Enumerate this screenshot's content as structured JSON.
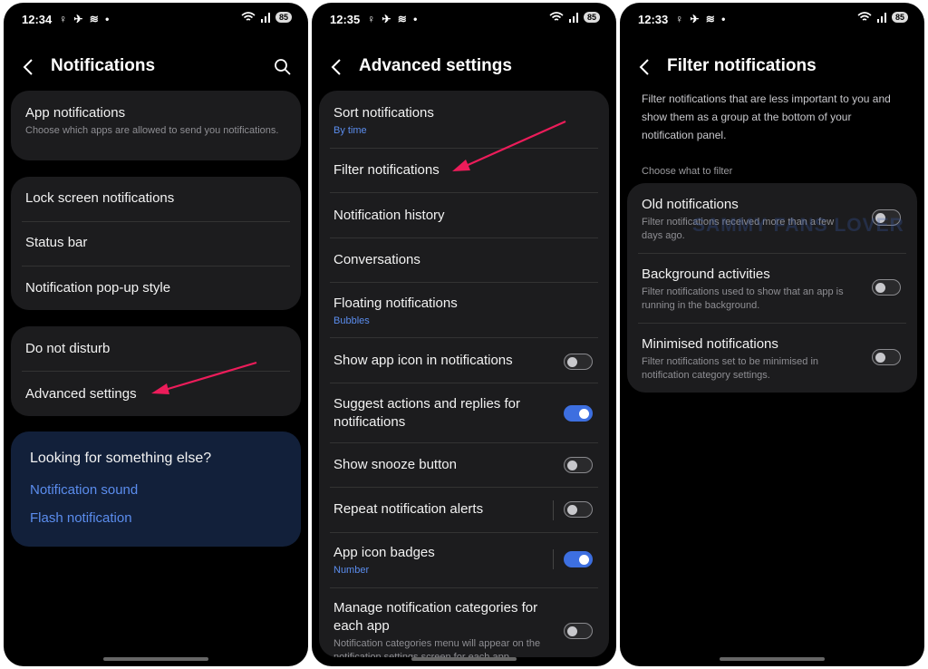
{
  "colors": {
    "accent": "#5b8dee",
    "arrow": "#ec1c5a",
    "toggle_on": "#3d6fe0",
    "card": "#1c1c1e"
  },
  "screen1": {
    "status": {
      "time": "12:34",
      "icons": "♀ ✈ ≋ •",
      "battery": "85"
    },
    "title": "Notifications",
    "app_notifications": {
      "title": "App notifications",
      "subtitle": "Choose which apps are allowed to send you notifications."
    },
    "items": [
      "Lock screen notifications",
      "Status bar",
      "Notification pop-up style"
    ],
    "items2": [
      "Do not disturb",
      "Advanced settings"
    ],
    "looking": {
      "heading": "Looking for something else?",
      "links": [
        "Notification sound",
        "Flash notification"
      ]
    }
  },
  "screen2": {
    "status": {
      "time": "12:35",
      "icons": "♀ ✈ ≋ •",
      "battery": "85"
    },
    "title": "Advanced settings",
    "rows": [
      {
        "title": "Sort notifications",
        "subtitle": "By time"
      },
      {
        "title": "Filter notifications"
      },
      {
        "title": "Notification history"
      },
      {
        "title": "Conversations"
      },
      {
        "title": "Floating notifications",
        "subtitle": "Bubbles"
      },
      {
        "title": "Show app icon in notifications",
        "toggle": false
      },
      {
        "title": "Suggest actions and replies for notifications",
        "toggle": true
      },
      {
        "title": "Show snooze button",
        "toggle": false
      },
      {
        "title": "Repeat notification alerts",
        "toggle": false
      },
      {
        "title": "App icon badges",
        "subtitle": "Number",
        "toggle": true
      },
      {
        "title": "Manage notification categories for each app",
        "subtitle": "Notification categories menu will appear on the notification settings screen for each app",
        "toggle": false
      }
    ]
  },
  "screen3": {
    "status": {
      "time": "12:33",
      "icons": "♀ ✈ ≋ •",
      "battery": "85"
    },
    "title": "Filter notifications",
    "description": "Filter notifications that are less important to you and show them as a group at the bottom of your notification panel.",
    "section": "Choose what to filter",
    "rows": [
      {
        "title": "Old notifications",
        "subtitle": "Filter notifications received more than a few days ago.",
        "toggle": false
      },
      {
        "title": "Background activities",
        "subtitle": "Filter notifications used to show that an app is running in the background.",
        "toggle": false
      },
      {
        "title": "Minimised notifications",
        "subtitle": "Filter notifications set to be minimised in notification category settings.",
        "toggle": false
      }
    ],
    "watermark": "SAMMY FANS LOVER"
  }
}
